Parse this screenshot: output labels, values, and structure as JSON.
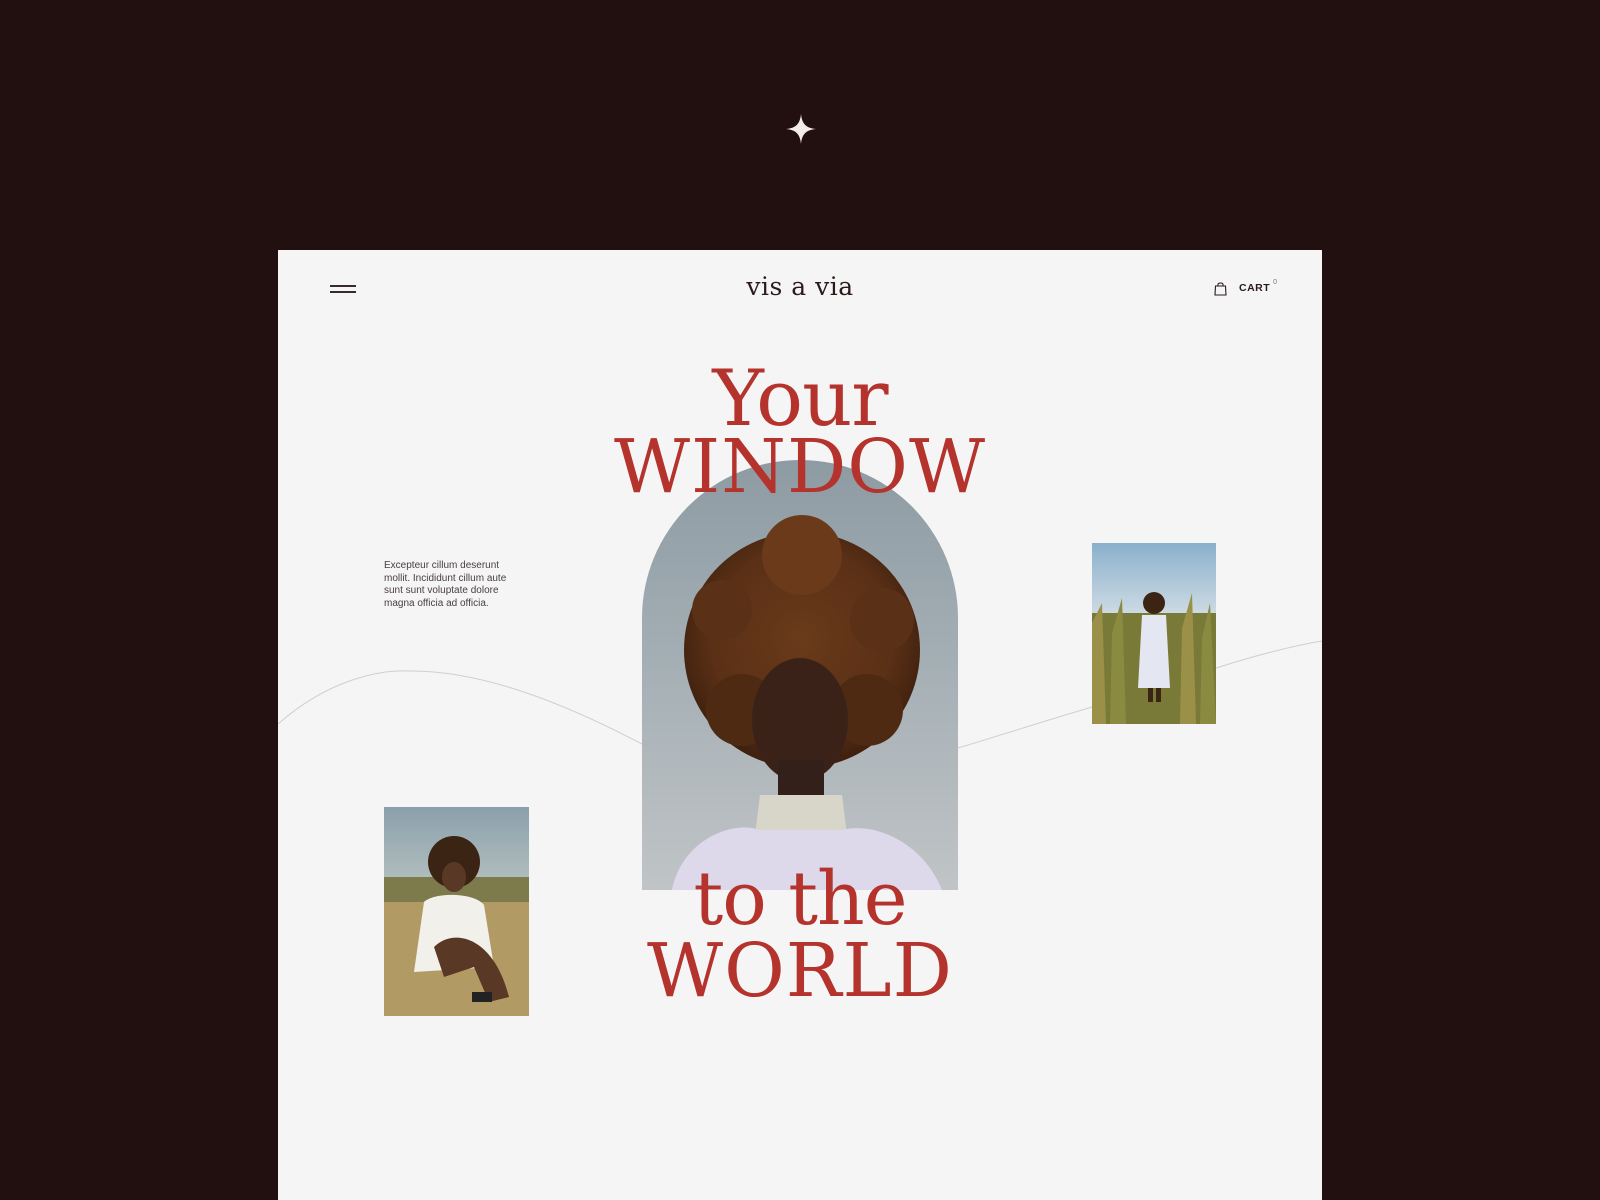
{
  "brand": {
    "logo_text": "vis a via"
  },
  "header": {
    "menu_icon": "hamburger-menu-icon",
    "cart_icon": "shopping-bag-icon",
    "cart_label": "CART",
    "cart_count": "0"
  },
  "hero": {
    "line1": "Your",
    "line2": "WINDOW",
    "line3": "to the",
    "line4": "WORLD",
    "intro_text": "Excepteur cillum deserunt mollit. Incididunt cillum aute sunt sunt voluptate dolore magna officia ad officia."
  },
  "decor": {
    "sparkle_icon": "sparkle-star-icon"
  },
  "colors": {
    "frame_background": "#220f0f",
    "page_background": "#f5f5f5",
    "accent": "#b5332d",
    "text_dark": "#2a1a1a"
  }
}
